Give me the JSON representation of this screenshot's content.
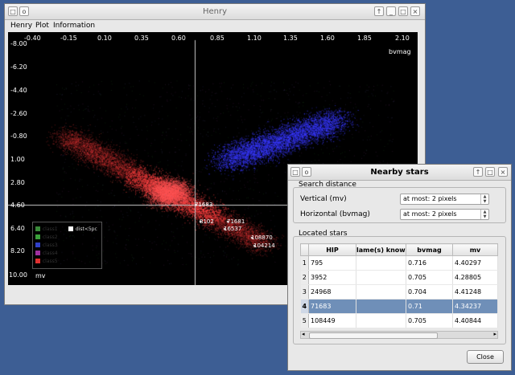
{
  "main_window": {
    "title": "Henry",
    "menu": [
      "Henry",
      "Plot",
      "Information"
    ]
  },
  "plot": {
    "x_ticks": [
      "-0.40",
      "-0.15",
      "0.10",
      "0.35",
      "0.60",
      "0.85",
      "1.10",
      "1.35",
      "1.60",
      "1.85",
      "2.10"
    ],
    "y_ticks": [
      "-8.00",
      "-6.20",
      "-4.40",
      "-2.60",
      "-0.80",
      "1.00",
      "2.80",
      "4.60",
      "6.40",
      "8.20",
      "10.00"
    ],
    "x_axis_label": "bvmag",
    "y_axis_label": "mv",
    "legend": {
      "items": [
        {
          "label": "class1",
          "color": "#3a8a3a"
        },
        {
          "label": "class2",
          "color": "#3aa03a"
        },
        {
          "label": "class3",
          "color": "#3040c8"
        },
        {
          "label": "class4",
          "color": "#a030a0"
        },
        {
          "label": "class5",
          "color": "#e03030"
        }
      ],
      "note": "dist<5pc"
    },
    "star_labels": [
      "71683",
      "8102",
      "71681",
      "16537",
      "108870",
      "104214"
    ],
    "colors": {
      "red": "#ff4040",
      "blue": "#3a3aff",
      "crosshair": "#cccccc"
    }
  },
  "dialog": {
    "title": "Nearby stars",
    "search_section": "Search distance",
    "vertical_label": "Vertical (mv)",
    "vertical_value": "at most: 2 pixels",
    "horizontal_label": "Horizontal (bvmag)",
    "horizontal_value": "at most: 2 pixels",
    "located_section": "Located stars",
    "columns": [
      "HIP",
      "lame(s) knowi",
      "bvmag",
      "mv"
    ],
    "rows": [
      {
        "n": "1",
        "hip": "795",
        "name": "",
        "bvmag": "0.716",
        "mv": "4.40297"
      },
      {
        "n": "2",
        "hip": "3952",
        "name": "",
        "bvmag": "0.705",
        "mv": "4.28805"
      },
      {
        "n": "3",
        "hip": "24968",
        "name": "",
        "bvmag": "0.704",
        "mv": "4.41248"
      },
      {
        "n": "4",
        "hip": "71683",
        "name": "",
        "bvmag": "0.71",
        "mv": "4.34237"
      },
      {
        "n": "5",
        "hip": "108449",
        "name": "",
        "bvmag": "0.705",
        "mv": "4.40844"
      }
    ],
    "selected_row": 3,
    "close_label": "Close"
  }
}
